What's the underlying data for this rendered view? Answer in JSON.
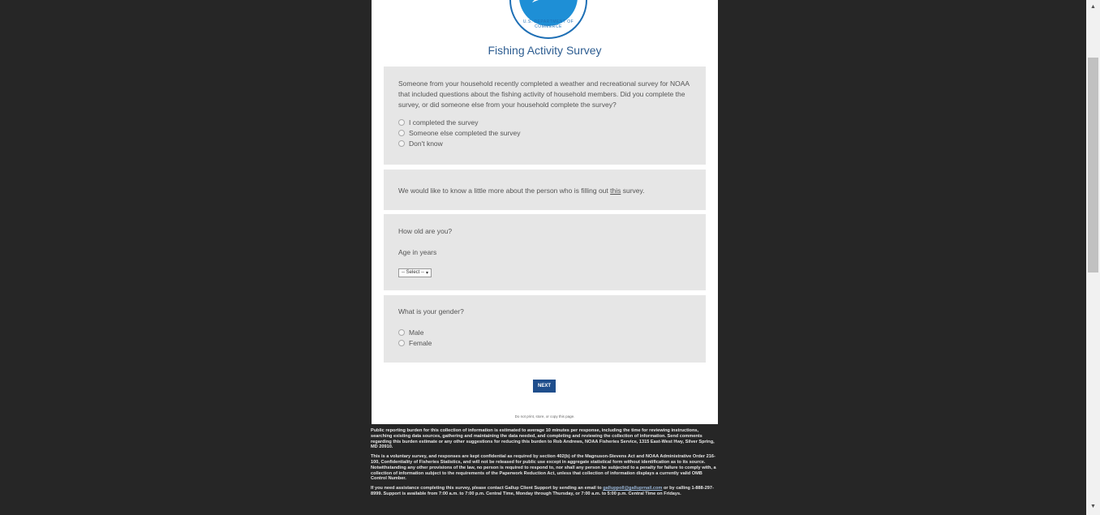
{
  "logo": {
    "ring_text": "U.S. DEPARTMENT OF COMMERCE"
  },
  "survey": {
    "title": "Fishing Activity Survey",
    "q1": {
      "text": "Someone from your household recently completed a weather and recreational survey for NOAA that included questions about the fishing activity of household members. Did you complete the survey, or did someone else from your household complete the survey?",
      "options": [
        "I completed the survey",
        "Someone else completed the survey",
        "Don't know"
      ]
    },
    "intro": {
      "before": "We would like to know a little more about the person who is filling out ",
      "underlined": "this",
      "after": " survey."
    },
    "q2": {
      "text": "How old are you?",
      "sublabel": "Age in years",
      "select_value": "-- Select --"
    },
    "q3": {
      "text": "What is your gender?",
      "options": [
        "Male",
        "Female"
      ]
    },
    "next_label": "NEXT",
    "no_print": "Do not print, store, or copy this page."
  },
  "footer": {
    "p1": "Public reporting burden for this collection of information is estimated to average 10 minutes per response, including the time for reviewing instructions, searching existing data sources, gathering and maintaining the data needed, and completing and reviewing the collection of information. Send comments regarding this burden estimate or any other suggestions for reducing this burden to Rob Andrews, NOAA Fisheries Service, 1315 East-West Hwy, Silver Spring, MD 20910.",
    "p2": "This is a voluntary survey, and responses are kept confidential as required by section 402(b) of the Magnuson-Stevens Act and NOAA Administrative Order 216-100, Confidentiality of Fisheries Statistics, and will not be released for public use except in aggregate statistical form without identification as to its source. Notwithstanding any other provisions of the law, no person is required to respond to, nor shall any person be subjected to a penalty for failure to comply with, a collection of information subject to the requirements of the Paperwork Reduction Act, unless that collection of information displays a currently valid OMB Control Number.",
    "p3_before": "If you need assistance completing this survey, please contact Gallup Client Support by sending an email to ",
    "p3_email": "galluppoll@galluprnail.com",
    "p3_after": " or by calling 1-888-297-8999. Support is available from 7:00 a.m. to 7:00 p.m. Central Time, Monday through Thursday, or 7:00 a.m. to 5:00 p.m. Central Time on Fridays."
  },
  "scrollbar": {
    "up_icon": "▲",
    "down_icon": "▼"
  }
}
